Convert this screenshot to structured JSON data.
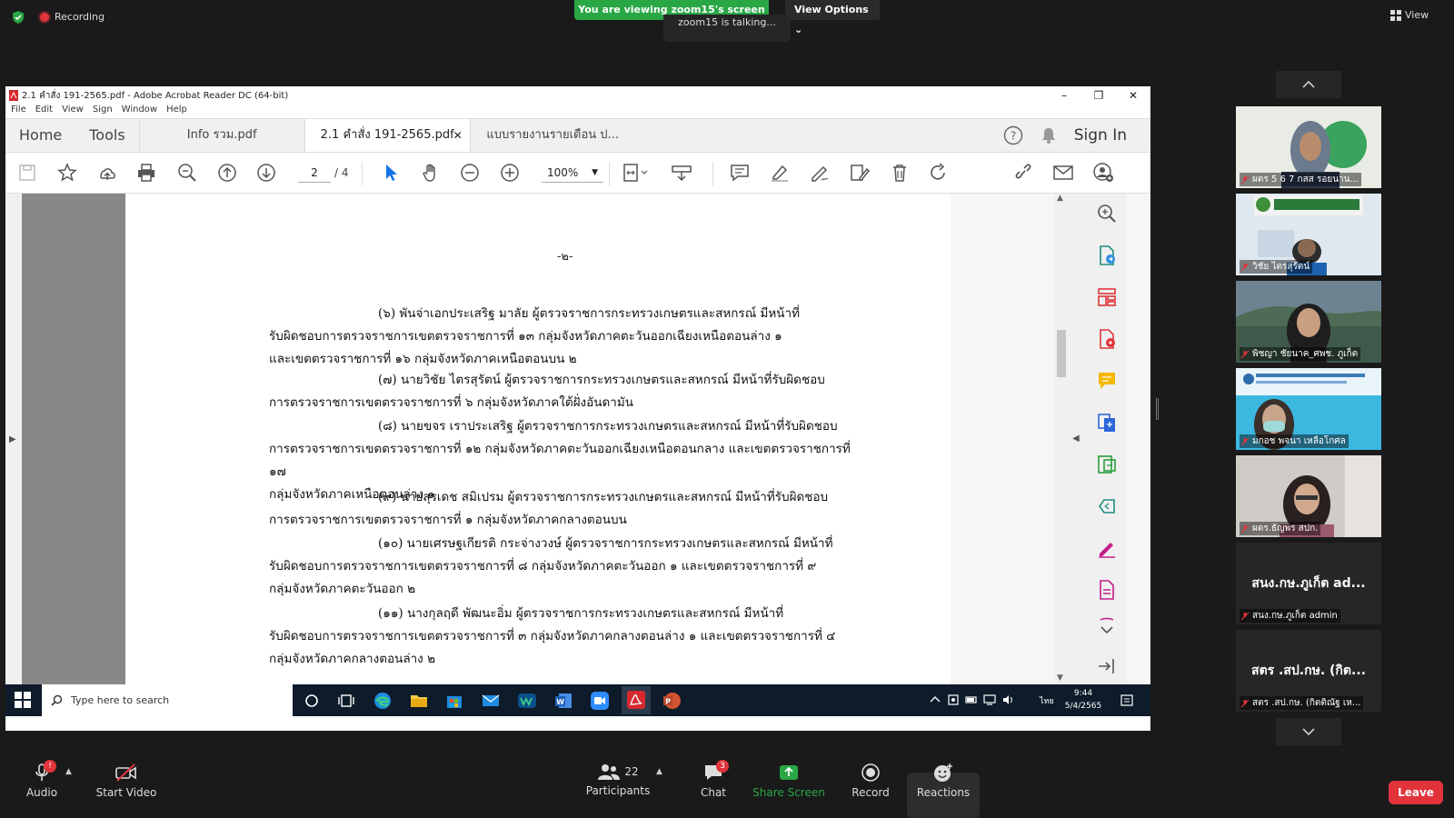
{
  "zoom": {
    "recording_label": "Recording",
    "viewing_banner": "You are viewing zoom15's screen",
    "view_options": "View Options",
    "talking": "zoom15 is talking...",
    "view_button": "View",
    "accent_green": "#29a745",
    "danger_red": "#e0343a"
  },
  "acrobat": {
    "window_title": "2.1 คำสั่ง 191-2565.pdf - Adobe Acrobat Reader DC (64-bit)",
    "menu": [
      "File",
      "Edit",
      "View",
      "Sign",
      "Window",
      "Help"
    ],
    "home_tab": "Home",
    "tools_tab": "Tools",
    "doc_tabs": [
      {
        "label": "Info รวม.pdf"
      },
      {
        "label": "2.1 คำสั่ง 191-2565.pdf"
      },
      {
        "label": "แบบรายงานรายเดือน ป..."
      }
    ],
    "sign_in": "Sign In",
    "page_current": "2",
    "page_total": "/ 4",
    "zoom_level": "100%"
  },
  "document": {
    "page_number_text": "-๒-",
    "paragraphs": [
      [
        "(๖) พันจ่าเอกประเสริฐ มาลัย ผู้ตรวจราชการกระทรวงเกษตรและสหกรณ์ มีหน้าที่",
        "รับผิดชอบการตรวจราชการเขตตรวจราชการที่ ๑๓ กลุ่มจังหวัดภาคตะวันออกเฉียงเหนือตอนล่าง ๑",
        "และเขตตรวจราชการที่ ๑๖ กลุ่มจังหวัดภาคเหนือตอนบน ๒"
      ],
      [
        "(๗) นายวิชัย ไตรสุรัตน์ ผู้ตรวจราชการกระทรวงเกษตรและสหกรณ์ มีหน้าที่รับผิดชอบ",
        "การตรวจราชการเขตตรวจราชการที่ ๖ กลุ่มจังหวัดภาคใต้ฝั่งอันดามัน"
      ],
      [
        "(๘) นายขจร เราประเสริฐ ผู้ตรวจราชการกระทรวงเกษตรและสหกรณ์ มีหน้าที่รับผิดชอบ",
        "การตรวจราชการเขตตรวจราชการที่ ๑๒ กลุ่มจังหวัดภาคตะวันออกเฉียงเหนือตอนกลาง และเขตตรวจราชการที่ ๑๗",
        "กลุ่มจังหวัดภาคเหนือตอนล่าง ๑"
      ],
      [
        "(๙) นายสุรเดช สมิเปรม ผู้ตรวจราชการกระทรวงเกษตรและสหกรณ์ มีหน้าที่รับผิดชอบ",
        "การตรวจราชการเขตตรวจราชการที่ ๑ กลุ่มจังหวัดภาคกลางตอนบน"
      ],
      [
        "(๑๐) นายเศรษฐเกียรติ กระจ่างวงษ์ ผู้ตรวจราชการกระทรวงเกษตรและสหกรณ์ มีหน้าที่",
        "รับผิดชอบการตรวจราชการเขตตรวจราชการที่ ๘ กลุ่มจังหวัดภาคตะวันออก ๑ และเขตตรวจราชการที่ ๙",
        "กลุ่มจังหวัดภาคตะวันออก ๒"
      ],
      [
        "(๑๑) นางกุลฤดี พัฒนะอิ่ม ผู้ตรวจราชการกระทรวงเกษตรและสหกรณ์ มีหน้าที่",
        "รับผิดชอบการตรวจราชการเขตตรวจราชการที่ ๓ กลุ่มจังหวัดภาคกลางตอนล่าง ๑ และเขตตรวจราชการที่ ๔",
        "กลุ่มจังหวัดภาคกลางตอนล่าง ๒"
      ]
    ]
  },
  "taskbar": {
    "search_placeholder": "Type here to search",
    "language": "ไทย",
    "time": "9:44",
    "date": "5/4/2565"
  },
  "participants": [
    {
      "name": "ผตร 5 6 7 กสส รอยนาน..."
    },
    {
      "name": "วิชัย ไตรสุรัตน์"
    },
    {
      "name": "พิชญา ชัยนาค_ศพช. ภูเก็ต"
    },
    {
      "name": "มกอช พจนา เหลือโกศล"
    },
    {
      "name": "ผตร.ธัญพร สปก."
    },
    {
      "name": "สนง.กษ.ภูเก็ต admin",
      "display": "สนง.กษ.ภูเก็ต ad..."
    },
    {
      "name": "สตร .สป.กษ. (กิตติณัฐ เห...",
      "display": "สตร .สป.กษ. (กิต..."
    }
  ],
  "controls": {
    "audio": "Audio",
    "audio_badge": "!",
    "start_video": "Start Video",
    "participants": "Participants",
    "participants_count": "22",
    "chat": "Chat",
    "chat_badge": "3",
    "share_screen": "Share Screen",
    "record": "Record",
    "reactions": "Reactions",
    "leave": "Leave"
  }
}
